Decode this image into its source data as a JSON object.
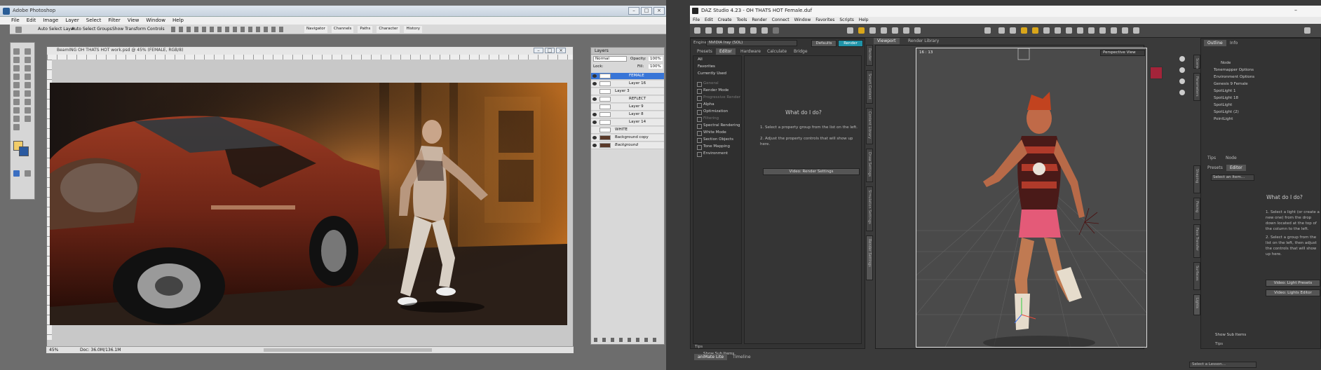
{
  "photoshop": {
    "title": "Adobe Photoshop",
    "menu": [
      "File",
      "Edit",
      "Image",
      "Layer",
      "Select",
      "Filter",
      "View",
      "Window",
      "Help"
    ],
    "options": {
      "auto_select_layer": "Auto Select Layer",
      "auto_select_groups": "Auto Select Groups",
      "show_transform": "Show Transform Controls"
    },
    "panel_tabs": [
      "Navigator",
      "Channels",
      "Paths",
      "Character",
      "History"
    ],
    "doc_title": "BeamING OH THATS HOT work.psd @ 45% (FEMALE, RGB/8)",
    "status_zoom": "45%",
    "status_doc": "Doc: 36.0M/136.1M",
    "layers_panel": {
      "title": "Layers",
      "blend": "Normal",
      "opacity_label": "Opacity:",
      "opacity": "100%",
      "fill_label": "Fill:",
      "fill": "100%",
      "lock_label": "Lock:",
      "rows": [
        "FEMALE",
        "Layer 16",
        "Layer 3",
        "REFLECT",
        "Layer 9",
        "Layer 8",
        "Layer 14",
        "WHITE",
        "Background copy",
        "Background"
      ]
    }
  },
  "daz": {
    "title": "DAZ Studio 4.23 - OH THATS HOT Female.duf",
    "menu": [
      "File",
      "Edit",
      "Create",
      "Tools",
      "Render",
      "Connect",
      "Window",
      "Favorites",
      "Scripts",
      "Help"
    ],
    "engine_label": "Engine:",
    "engine_value": "NVIDIA Iray (SOL)",
    "defaults_btn": "Defaults",
    "render_btn": "Render",
    "render_tabs": [
      "Presets",
      "Editor",
      "Hardware",
      "Calculate",
      "Bridge"
    ],
    "render_groups": [
      "All",
      "Favorites",
      "Currently Used"
    ],
    "render_list": [
      "General",
      "Render Mode",
      "Progressive Render",
      "Alpha",
      "Optimization",
      "Filtering",
      "Spectral Rendering",
      "White Mode",
      "Section Objects",
      "Tone Mapping",
      "Environment"
    ],
    "what_title": "What do I do?",
    "help1": "1. Select a property group from the list on the left.",
    "help2": "2. Adjust the property controls that will show up here.",
    "video_render_btn": "Video: Render Settings",
    "show_sub_items": "Show Sub Items",
    "tips_label": "Tips",
    "bottom_tabs": [
      "aniMate Lite",
      "Timeline"
    ],
    "viewport_tabs": [
      "Viewport",
      "Render Library"
    ],
    "fps": "16 : 13",
    "perspective": "Perspective View",
    "left_sidetabs": [
      "Render",
      "Smart Content",
      "Content Library",
      "Draw Settings",
      "Simulation Settings",
      "Render Settings"
    ],
    "scene": {
      "tabs": [
        "Outline",
        "Info"
      ],
      "header": "Node",
      "items": [
        "Tonemapper Options",
        "Environment Options",
        "Genesis 9 Female",
        "SpotLight 1",
        "SpotLight 18",
        "SpotLight",
        "SpotLight (2)",
        "PointLight"
      ]
    },
    "lights": {
      "tabs": [
        "Presets",
        "Editor"
      ],
      "select_item": "Select an Item...",
      "what_title": "What do I do?",
      "help1": "1. Select a light (or create a new one) from the drop down located at the top of the column to the left.",
      "help2": "2. Select a group from the list on the left, then adjust the controls that will show up here.",
      "video_presets": "Video: Light Presets",
      "video_editor": "Video: Lights Editor",
      "show_sub_items": "Show Sub Items",
      "tips_label": "Tips"
    },
    "right_tabs1": [
      "Tips",
      "Node"
    ],
    "right_sidetabs": [
      "Scene",
      "Parameters",
      "Shaping",
      "Posing",
      "Face Transfer",
      "Surfaces",
      "Lights"
    ],
    "lesson": "Select a Lesson..."
  }
}
